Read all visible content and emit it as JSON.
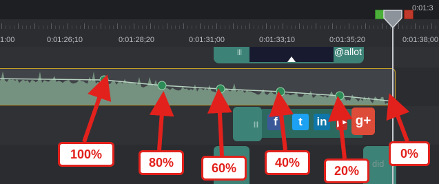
{
  "ruler": {
    "timecodes": [
      "1:00",
      "0:01:26;10",
      "0:01:28;20",
      "0:01:31;00",
      "0:01:33;10",
      "0:01:35;20",
      "0:01:38;00"
    ],
    "top_right_timecode": "0:01:3"
  },
  "clips": {
    "video_caption": "@allot",
    "social_icons": [
      "f",
      "t",
      "in",
      "▶",
      "g+"
    ]
  },
  "volume_keyframes": [
    "100%",
    "80%",
    "60%",
    "40%",
    "20%",
    "0%"
  ],
  "colors": {
    "clip_teal": "#3d8276",
    "audio_wave": "#7f9f8a",
    "audio_border": "#c9a227",
    "keyframe": "#2e8b57",
    "callout_red": "#e2211c"
  }
}
